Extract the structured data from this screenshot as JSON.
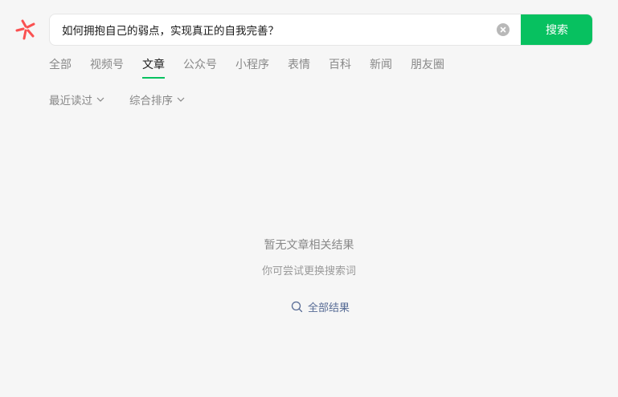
{
  "search": {
    "query": "如何拥抱自己的弱点，实现真正的自我完善？",
    "button_label": "搜索"
  },
  "tabs": [
    {
      "label": "全部",
      "active": false
    },
    {
      "label": "视频号",
      "active": false
    },
    {
      "label": "文章",
      "active": true
    },
    {
      "label": "公众号",
      "active": false
    },
    {
      "label": "小程序",
      "active": false
    },
    {
      "label": "表情",
      "active": false
    },
    {
      "label": "百科",
      "active": false
    },
    {
      "label": "新闻",
      "active": false
    },
    {
      "label": "朋友圈",
      "active": false
    }
  ],
  "filters": {
    "time": "最近读过",
    "sort": "综合排序"
  },
  "empty": {
    "title": "暂无文章相关结果",
    "hint": "你可尝试更换搜索词",
    "all_results_label": "全部结果"
  },
  "colors": {
    "accent": "#07c160",
    "logo": "#fa5151",
    "link": "#576b95"
  }
}
